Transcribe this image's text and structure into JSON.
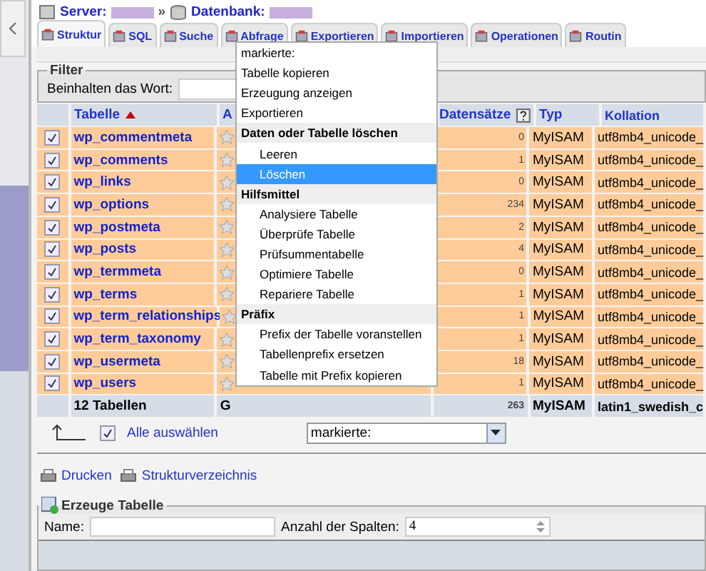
{
  "breadcrumb": {
    "server_label": "Server:",
    "separator": "»",
    "database_label": "Datenbank:"
  },
  "tabs": [
    {
      "label": "Struktur",
      "selected": true
    },
    {
      "label": "SQL",
      "selected": false
    },
    {
      "label": "Suche",
      "selected": false
    },
    {
      "label": "Abfrage",
      "selected": false
    },
    {
      "label": "Exportieren",
      "selected": false
    },
    {
      "label": "Importieren",
      "selected": false
    },
    {
      "label": "Operationen",
      "selected": false
    },
    {
      "label": "Routin",
      "selected": false
    }
  ],
  "filter": {
    "legend": "Filter",
    "label": "Beinhalten das Wort:"
  },
  "table": {
    "columns": [
      {
        "label": "Tabelle",
        "kind": "sorted"
      },
      {
        "label": "A",
        "kind": "plain"
      },
      {
        "label": "Datensätze",
        "kind": "help"
      },
      {
        "label": "Typ",
        "kind": "plain"
      },
      {
        "label": "Kollation",
        "kind": "plain"
      }
    ],
    "rows": [
      {
        "name": "wp_commentmeta",
        "checked": true,
        "records": "0",
        "type": "MyISAM",
        "collation": "utf8mb4_unicode_"
      },
      {
        "name": "wp_comments",
        "checked": true,
        "records": "1",
        "type": "MyISAM",
        "collation": "utf8mb4_unicode_"
      },
      {
        "name": "wp_links",
        "checked": true,
        "records": "0",
        "type": "MyISAM",
        "collation": "utf8mb4_unicode_"
      },
      {
        "name": "wp_options",
        "checked": true,
        "records": "234",
        "type": "MyISAM",
        "collation": "utf8mb4_unicode_"
      },
      {
        "name": "wp_postmeta",
        "checked": true,
        "records": "2",
        "type": "MyISAM",
        "collation": "utf8mb4_unicode_"
      },
      {
        "name": "wp_posts",
        "checked": true,
        "records": "4",
        "type": "MyISAM",
        "collation": "utf8mb4_unicode_"
      },
      {
        "name": "wp_termmeta",
        "checked": true,
        "records": "0",
        "type": "MyISAM",
        "collation": "utf8mb4_unicode_"
      },
      {
        "name": "wp_terms",
        "checked": true,
        "records": "1",
        "type": "MyISAM",
        "collation": "utf8mb4_unicode_"
      },
      {
        "name": "wp_term_relationships",
        "checked": true,
        "records": "1",
        "type": "MyISAM",
        "collation": "utf8mb4_unicode_"
      },
      {
        "name": "wp_term_taxonomy",
        "checked": true,
        "records": "1",
        "type": "MyISAM",
        "collation": "utf8mb4_unicode_"
      },
      {
        "name": "wp_usermeta",
        "checked": true,
        "records": "18",
        "type": "MyISAM",
        "collation": "utf8mb4_unicode_"
      },
      {
        "name": "wp_users",
        "checked": true,
        "records": "1",
        "type": "MyISAM",
        "collation": "utf8mb4_unicode_"
      }
    ],
    "footer": {
      "name": "12 Tabellen",
      "column_2": "G",
      "records": "263",
      "type": "MyISAM",
      "collation": "latin1_swedish_c"
    }
  },
  "select_all": {
    "label": "Alle auswählen",
    "checked": true
  },
  "action_select": {
    "value": "markierte:"
  },
  "menu": [
    {
      "label": "markierte:",
      "kind": "option",
      "selected": false
    },
    {
      "label": "Tabelle kopieren",
      "kind": "option",
      "selected": false
    },
    {
      "label": "Erzeugung anzeigen",
      "kind": "option",
      "selected": false
    },
    {
      "label": "Exportieren",
      "kind": "option",
      "selected": false
    },
    {
      "label": "Daten oder Tabelle löschen",
      "kind": "group"
    },
    {
      "label": "Leeren",
      "kind": "sub",
      "selected": false
    },
    {
      "label": "Löschen",
      "kind": "sub",
      "selected": true
    },
    {
      "label": "Hilfsmittel",
      "kind": "group"
    },
    {
      "label": "Analysiere Tabelle",
      "kind": "sub",
      "selected": false
    },
    {
      "label": "Überprüfe Tabelle",
      "kind": "sub",
      "selected": false
    },
    {
      "label": "Prüfsummentabelle",
      "kind": "sub",
      "selected": false
    },
    {
      "label": "Optimiere Tabelle",
      "kind": "sub",
      "selected": false
    },
    {
      "label": "Repariere Tabelle",
      "kind": "sub",
      "selected": false
    },
    {
      "label": "Präfix",
      "kind": "group"
    },
    {
      "label": "Prefix der Tabelle voranstellen",
      "kind": "sub",
      "selected": false
    },
    {
      "label": "Tabellenprefix ersetzen",
      "kind": "sub",
      "selected": false
    },
    {
      "label": "Tabelle mit Prefix kopieren",
      "kind": "sub",
      "selected": false
    }
  ],
  "links": [
    "Drucken",
    "Strukturverzeichnis"
  ],
  "create_table": {
    "legend": "Erzeuge Tabelle",
    "name_label": "Name:",
    "columns_label": "Anzahl der Spalten:",
    "columns_value": "4"
  }
}
